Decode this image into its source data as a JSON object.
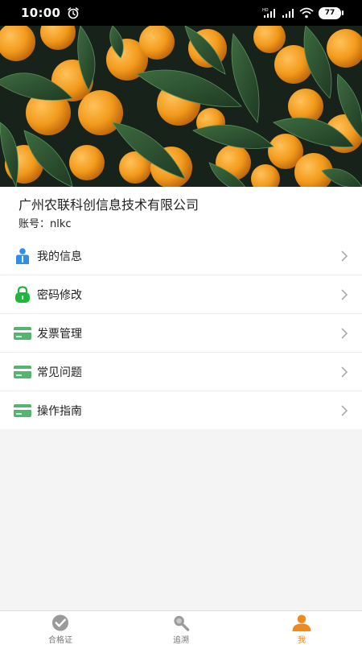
{
  "status_bar": {
    "time": "10:00",
    "battery": "77",
    "icons": [
      "alarm-icon",
      "hd-signal-icon",
      "signal-icon",
      "wifi-icon",
      "battery-icon"
    ]
  },
  "banner": {
    "image": "tangerines-with-leaves-photo"
  },
  "company": {
    "name": "广州农联科创信息技术有限公司",
    "account_label": "账号：",
    "account_value": "nlkc"
  },
  "menu": {
    "items": [
      {
        "label": "我的信息",
        "icon": "user-info-icon",
        "icon_color": "#2d8fe8"
      },
      {
        "label": "密码修改",
        "icon": "lock-icon",
        "icon_color": "#1fb83a"
      },
      {
        "label": "发票管理",
        "icon": "card-icon",
        "icon_color": "#52b66e"
      },
      {
        "label": "常见问题",
        "icon": "card-icon",
        "icon_color": "#52b66e"
      },
      {
        "label": "操作指南",
        "icon": "card-icon",
        "icon_color": "#52b66e"
      }
    ]
  },
  "tabbar": {
    "tabs": [
      {
        "label": "合格证",
        "icon": "checkmark-circle-icon",
        "active": false
      },
      {
        "label": "追溯",
        "icon": "magnifier-icon",
        "active": false
      },
      {
        "label": "我",
        "icon": "person-icon",
        "active": true
      }
    ],
    "active_color": "#f08a1c"
  }
}
